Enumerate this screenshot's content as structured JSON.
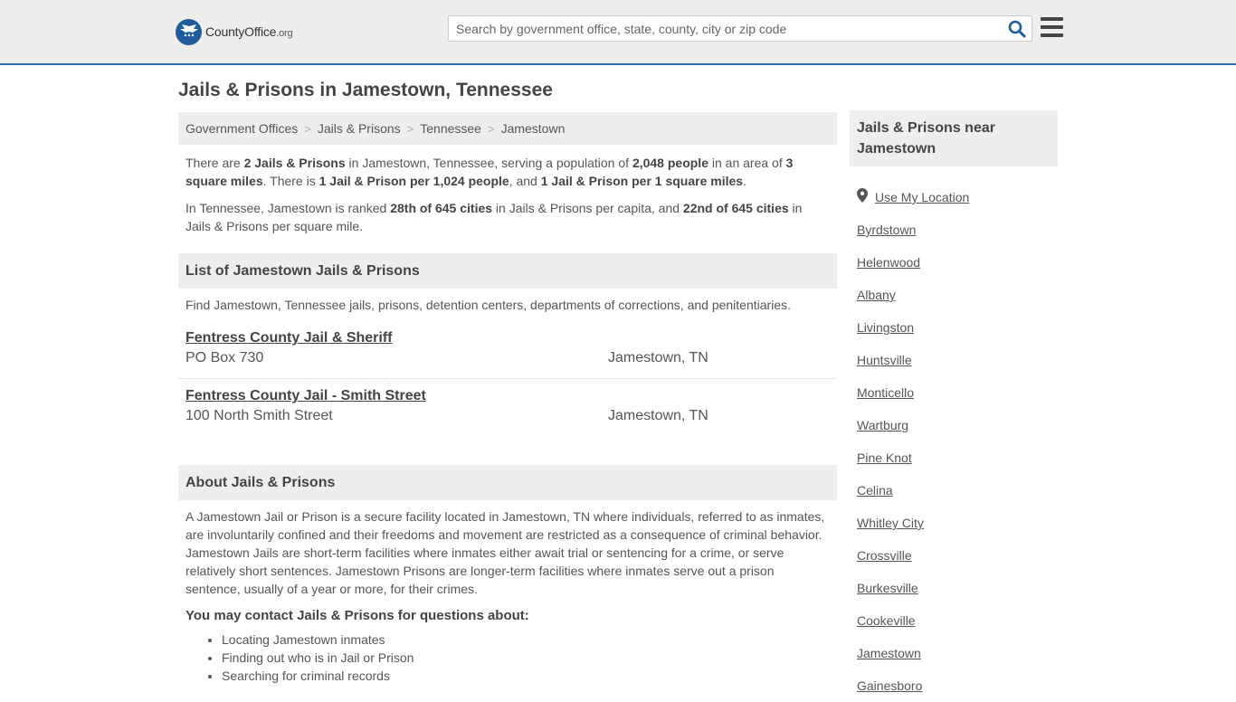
{
  "header": {
    "logo_name": "CountyOffice",
    "logo_tld": ".org",
    "search_placeholder": "Search by government office, state, county, city or zip code"
  },
  "page": {
    "title": "Jails & Prisons in Jamestown, Tennessee"
  },
  "breadcrumb": [
    "Government Offices",
    "Jails & Prisons",
    "Tennessee",
    "Jamestown"
  ],
  "summary": {
    "p1": {
      "a": "There are ",
      "b1": "2 Jails & Prisons",
      "c": " in Jamestown, Tennessee, serving a population of ",
      "b2": "2,048 people",
      "d": " in an area of ",
      "b3": "3 square miles",
      "e": ". There is ",
      "b4": "1 Jail & Prison per 1,024 people",
      "f": ", and ",
      "b5": "1 Jail & Prison per 1 square miles",
      "g": "."
    },
    "p2": {
      "a": "In Tennessee, Jamestown is ranked ",
      "b1": "28th of 645 cities",
      "c": " in Jails & Prisons per capita, and ",
      "b2": "22nd of 645 cities",
      "d": " in Jails & Prisons per square mile."
    }
  },
  "list_section": {
    "heading": "List of Jamestown Jails & Prisons",
    "intro": "Find Jamestown, Tennessee jails, prisons, detention centers, departments of corrections, and penitentiaries.",
    "items": [
      {
        "name": "Fentress County Jail & Sheriff",
        "address": "PO Box 730",
        "city": "Jamestown, TN"
      },
      {
        "name": "Fentress County Jail - Smith Street",
        "address": "100 North Smith Street",
        "city": "Jamestown, TN"
      }
    ]
  },
  "about": {
    "heading": "About Jails & Prisons",
    "body": "A Jamestown Jail or Prison is a secure facility located in Jamestown, TN where individuals, referred to as inmates, are involuntarily confined and their freedoms and movement are restricted as a consequence of criminal behavior. Jamestown Jails are short-term facilities where inmates either await trial or sentencing for a crime, or serve relatively short sentences. Jamestown Prisons are longer-term facilities where inmates serve out a prison sentence, usually of a year or more, for their crimes.",
    "contact_heading": "You may contact Jails & Prisons for questions about:",
    "topics": [
      "Locating Jamestown inmates",
      "Finding out who is in Jail or Prison",
      "Searching for criminal records"
    ]
  },
  "sidebar": {
    "heading": "Jails & Prisons near Jamestown",
    "use_location": "Use My Location",
    "cities": [
      "Byrdstown",
      "Helenwood",
      "Albany",
      "Livingston",
      "Huntsville",
      "Monticello",
      "Wartburg",
      "Pine Knot",
      "Celina",
      "Whitley City",
      "Crossville",
      "Burkesville",
      "Cookeville",
      "Jamestown",
      "Gainesboro"
    ]
  },
  "icons": {
    "logo": "eagle-seal-icon",
    "search": "search-icon",
    "menu": "hamburger-menu-icon",
    "location": "map-pin-icon"
  },
  "colors": {
    "brand_blue": "#1f5c99",
    "header_border": "#2e6da4",
    "search_icon": "#1f5c99"
  }
}
